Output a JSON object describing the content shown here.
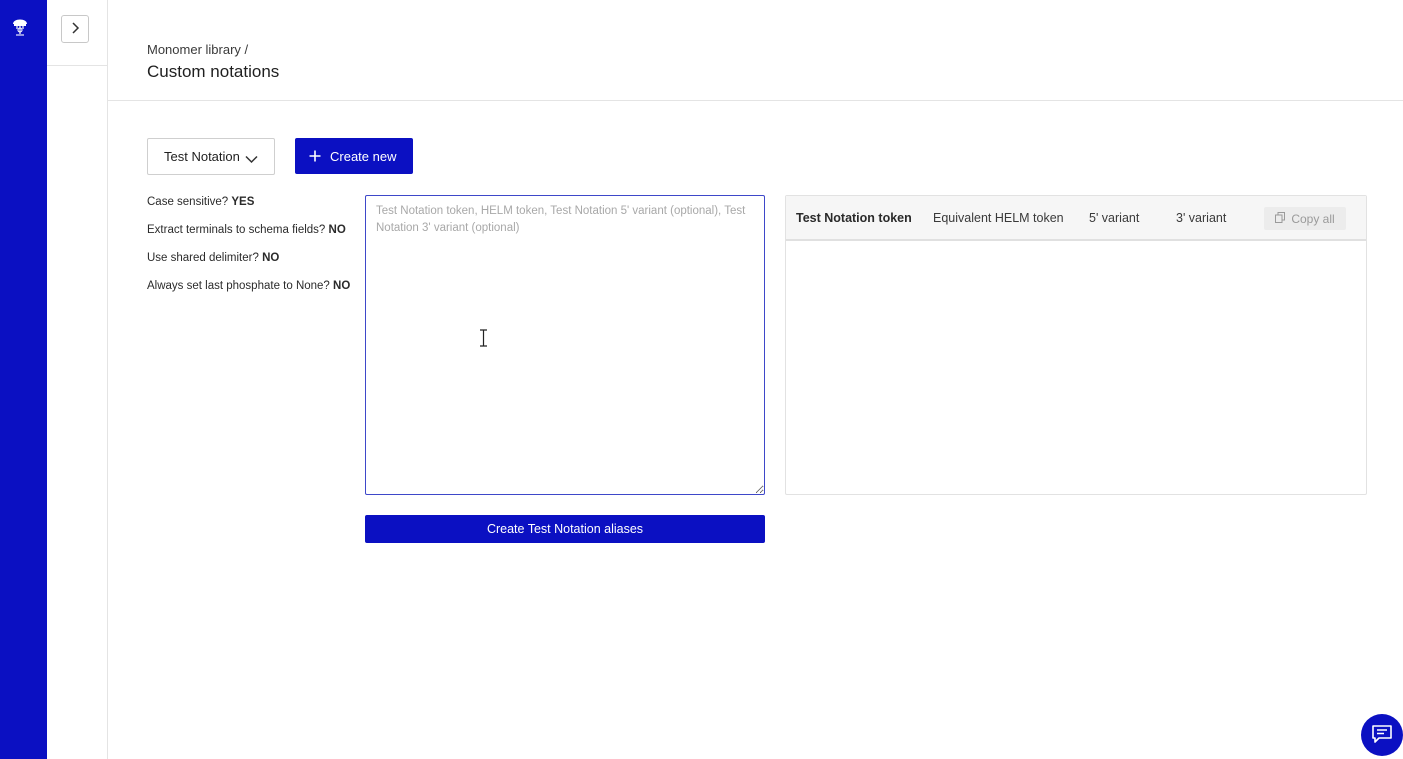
{
  "colors": {
    "brand": "#0b10c2",
    "border": "#e4e4e4",
    "placeholder": "#a8a8a8"
  },
  "icons": {
    "rail_logo": "jellyfish-logo-icon",
    "expand": "chevron-right-icon",
    "select": "chevron-down-icon",
    "create": "plus-icon",
    "copy": "copy-icon",
    "chat": "chat-icon",
    "cursor": "text-cursor-icon"
  },
  "header": {
    "breadcrumb": "Monomer library /",
    "title": "Custom notations"
  },
  "toolbar": {
    "selected_notation": "Test Notation",
    "create_new_label": "Create new"
  },
  "settings": [
    {
      "label": "Case sensitive?",
      "value": "YES"
    },
    {
      "label": "Extract terminals to schema fields?",
      "value": "NO"
    },
    {
      "label": "Use shared delimiter?",
      "value": "NO"
    },
    {
      "label": "Always set last phosphate to None?",
      "value": "NO"
    }
  ],
  "editor": {
    "value": "",
    "placeholder": "Test Notation token, HELM token, Test Notation 5' variant (optional), Test Notation 3' variant (optional)",
    "submit_label": "Create Test Notation aliases"
  },
  "preview": {
    "columns": [
      "Test Notation token",
      "Equivalent HELM token",
      "5' variant",
      "3' variant"
    ],
    "copy_all_label": "Copy all",
    "rows": []
  }
}
